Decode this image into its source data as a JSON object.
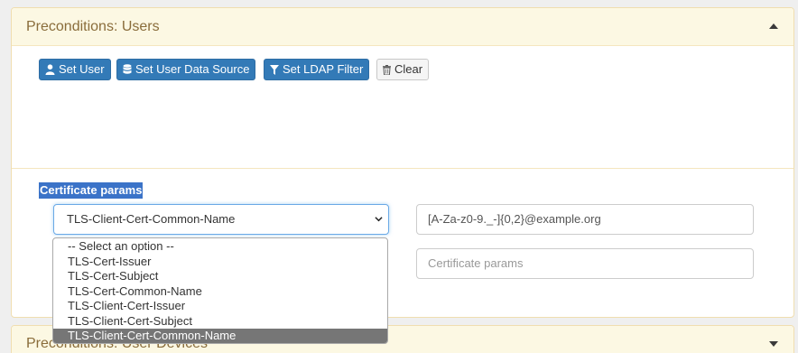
{
  "panel_users": {
    "title": "Preconditions: Users",
    "buttons": {
      "set_user": "Set User",
      "set_user_data_source": "Set User Data Source",
      "set_ldap_filter": "Set LDAP Filter",
      "clear": "Clear"
    }
  },
  "certificate": {
    "label": "Certificate params",
    "selected": "TLS-Client-Cert-Common-Name",
    "options": [
      "-- Select an option --",
      "TLS-Cert-Issuer",
      "TLS-Cert-Subject",
      "TLS-Cert-Common-Name",
      "TLS-Client-Cert-Issuer",
      "TLS-Client-Cert-Subject",
      "TLS-Client-Cert-Common-Name"
    ],
    "value_input": "[A-Za-z0-9._-]{0,2}@example.org",
    "params_placeholder": "Certificate params"
  },
  "panel_devices": {
    "title": "Preconditions: User Devices"
  },
  "colors": {
    "primary": "#337ab7",
    "panel_heading_bg": "#fcf8e3",
    "panel_title": "#8a6d3b",
    "highlight": "#3b73c8",
    "option_selected_bg": "#767676"
  },
  "icons": [
    "user-icon",
    "database-icon",
    "filter-icon",
    "trash-icon",
    "caret-up-icon",
    "caret-down-icon",
    "chevron-down-icon"
  ]
}
